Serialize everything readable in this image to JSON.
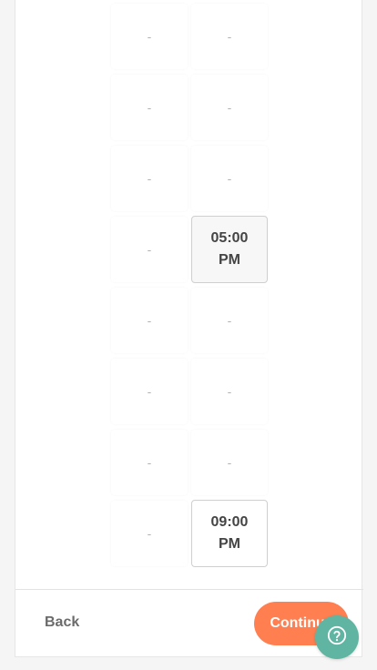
{
  "schedule": {
    "empty_label": "-",
    "rows": [
      {
        "col0": "-",
        "col1": "-"
      },
      {
        "col0": "-",
        "col1": "-"
      },
      {
        "col0": "-",
        "col1": "-"
      },
      {
        "col0": "-",
        "col1": "05:00 PM"
      },
      {
        "col0": "-",
        "col1": "-"
      },
      {
        "col0": "-",
        "col1": "-"
      },
      {
        "col0": "-",
        "col1": "-"
      },
      {
        "col0": "-",
        "col1": "09:00 PM"
      }
    ]
  },
  "footer": {
    "back_label": "Back",
    "continue_label": "Continue"
  },
  "help": {
    "icon": "help-circle-icon"
  },
  "colors": {
    "continue_bg": "#ff7f50",
    "help_bg": "#5fb5a2",
    "text_muted": "#6b6b6b"
  }
}
